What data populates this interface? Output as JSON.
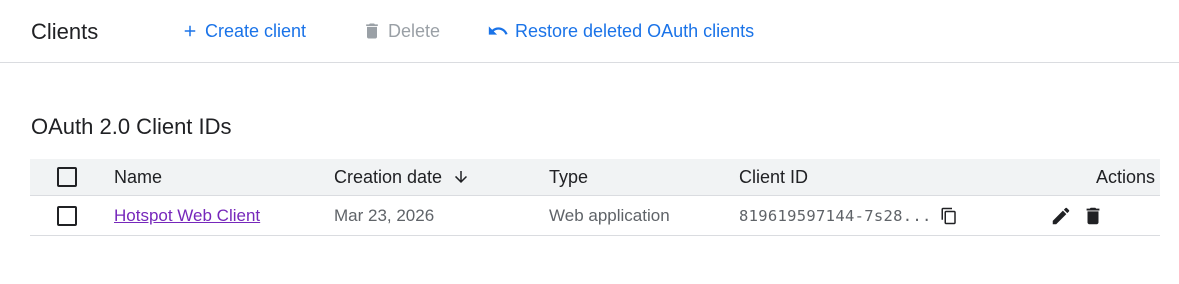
{
  "header": {
    "title": "Clients",
    "create_label": "Create client",
    "delete_label": "Delete",
    "restore_label": "Restore deleted OAuth clients"
  },
  "section": {
    "title": "OAuth 2.0 Client IDs"
  },
  "table": {
    "columns": {
      "name": "Name",
      "creation_date": "Creation date",
      "type": "Type",
      "client_id": "Client ID",
      "actions": "Actions"
    },
    "sort": {
      "column": "creation_date",
      "direction": "descending"
    },
    "rows": [
      {
        "name": "Hotspot Web Client",
        "creation_date": "Mar 23, 2026",
        "type": "Web application",
        "client_id": "819619597144-7s28..."
      }
    ]
  },
  "icons": {
    "create": "plus-icon",
    "delete": "trash-icon",
    "restore": "undo-icon",
    "sort": "arrow-down-icon",
    "copy": "copy-icon",
    "edit": "pencil-icon",
    "row_delete": "trash-icon"
  },
  "colors": {
    "primary": "#1a73e8",
    "disabled": "#9aa0a6",
    "visited_link": "#7627bb",
    "header_bg": "#f1f3f4",
    "divider": "#dadce0"
  }
}
